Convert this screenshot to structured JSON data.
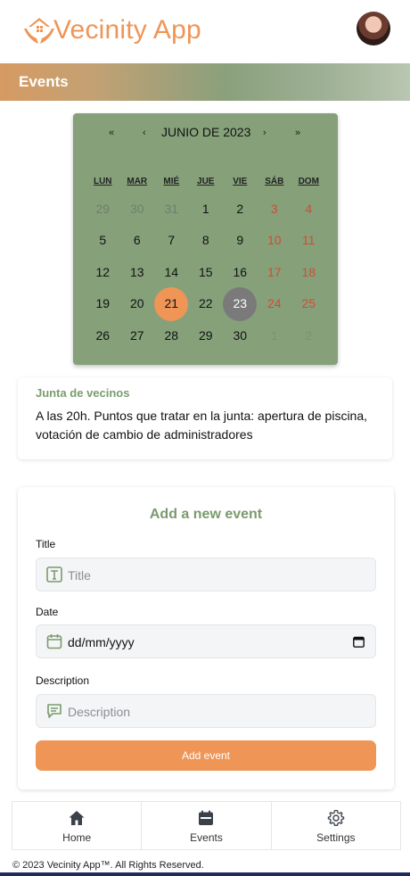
{
  "app": {
    "name": "Vecinity App",
    "accent": "#ef9556",
    "green": "#86a17a"
  },
  "header": {
    "section_title": "Events"
  },
  "calendar": {
    "nav": {
      "prev_year": "«",
      "prev_month": "‹",
      "month_label": "JUNIO DE 2023",
      "next_month": "›",
      "next_year": "»"
    },
    "weekdays": [
      "LUN",
      "MAR",
      "MIÉ",
      "JUE",
      "VIE",
      "SÁB",
      "DOM"
    ],
    "days": [
      {
        "n": "29",
        "muted": true
      },
      {
        "n": "30",
        "muted": true
      },
      {
        "n": "31",
        "muted": true
      },
      {
        "n": "1"
      },
      {
        "n": "2"
      },
      {
        "n": "3",
        "weekend": true
      },
      {
        "n": "4",
        "weekend": true
      },
      {
        "n": "5"
      },
      {
        "n": "6"
      },
      {
        "n": "7"
      },
      {
        "n": "8"
      },
      {
        "n": "9"
      },
      {
        "n": "10",
        "weekend": true
      },
      {
        "n": "11",
        "weekend": true
      },
      {
        "n": "12"
      },
      {
        "n": "13"
      },
      {
        "n": "14"
      },
      {
        "n": "15"
      },
      {
        "n": "16"
      },
      {
        "n": "17",
        "weekend": true
      },
      {
        "n": "18",
        "weekend": true
      },
      {
        "n": "19"
      },
      {
        "n": "20"
      },
      {
        "n": "21",
        "today": true
      },
      {
        "n": "22"
      },
      {
        "n": "23",
        "selected": true
      },
      {
        "n": "24",
        "weekend": true
      },
      {
        "n": "25",
        "weekend": true
      },
      {
        "n": "26"
      },
      {
        "n": "27"
      },
      {
        "n": "28"
      },
      {
        "n": "29"
      },
      {
        "n": "30"
      },
      {
        "n": "1",
        "muted": true,
        "weekend": true
      },
      {
        "n": "2",
        "muted": true,
        "weekend": true
      }
    ]
  },
  "event": {
    "title": "Junta de vecinos",
    "description": "A las 20h. Puntos que tratar en la junta: apertura de piscina, votación de cambio de administradores"
  },
  "form": {
    "heading": "Add a new event",
    "title_label": "Title",
    "title_placeholder": "Title",
    "date_label": "Date",
    "date_value": "dd/mm/yyyy",
    "description_label": "Description",
    "description_placeholder": "Description",
    "submit_label": "Add event"
  },
  "bottom_nav": [
    {
      "label": "Home",
      "icon": "home-icon"
    },
    {
      "label": "Events",
      "icon": "calendar-icon"
    },
    {
      "label": "Settings",
      "icon": "gear-icon"
    }
  ],
  "footer": {
    "text": "© 2023 Vecinity App™. All Rights Reserved."
  }
}
